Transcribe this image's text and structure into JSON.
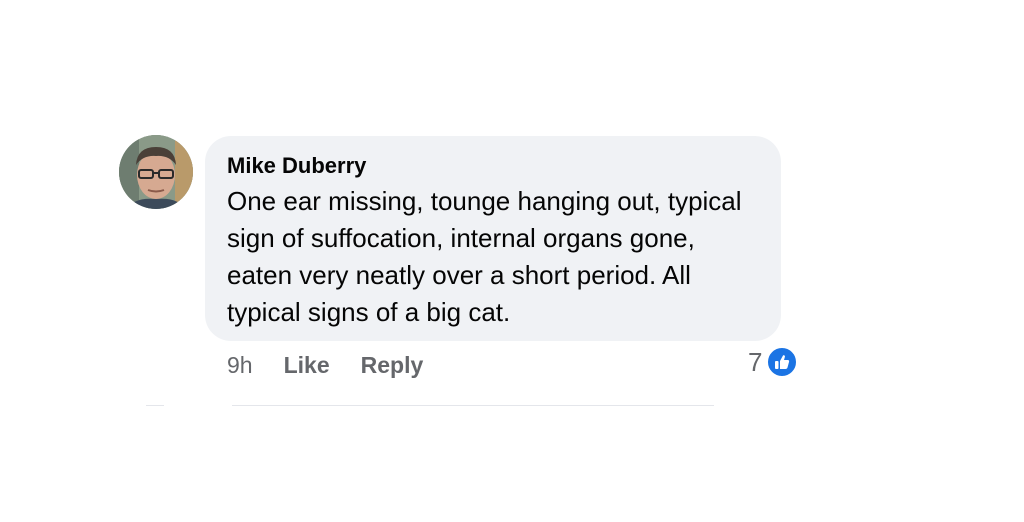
{
  "comment": {
    "author": "Mike Duberry",
    "text": "One ear missing, tounge hanging out, typical sign of suffocation, internal organs gone, eaten very neatly over a short period. All typical signs of a big cat.",
    "time": "9h",
    "like_label": "Like",
    "reply_label": "Reply",
    "reaction_count": "7",
    "reaction_icon": "like-thumbs-up-icon"
  },
  "colors": {
    "bubble": "#f0f2f5",
    "text": "#050505",
    "secondary": "#65676b",
    "like_blue": "#1b74e4"
  }
}
